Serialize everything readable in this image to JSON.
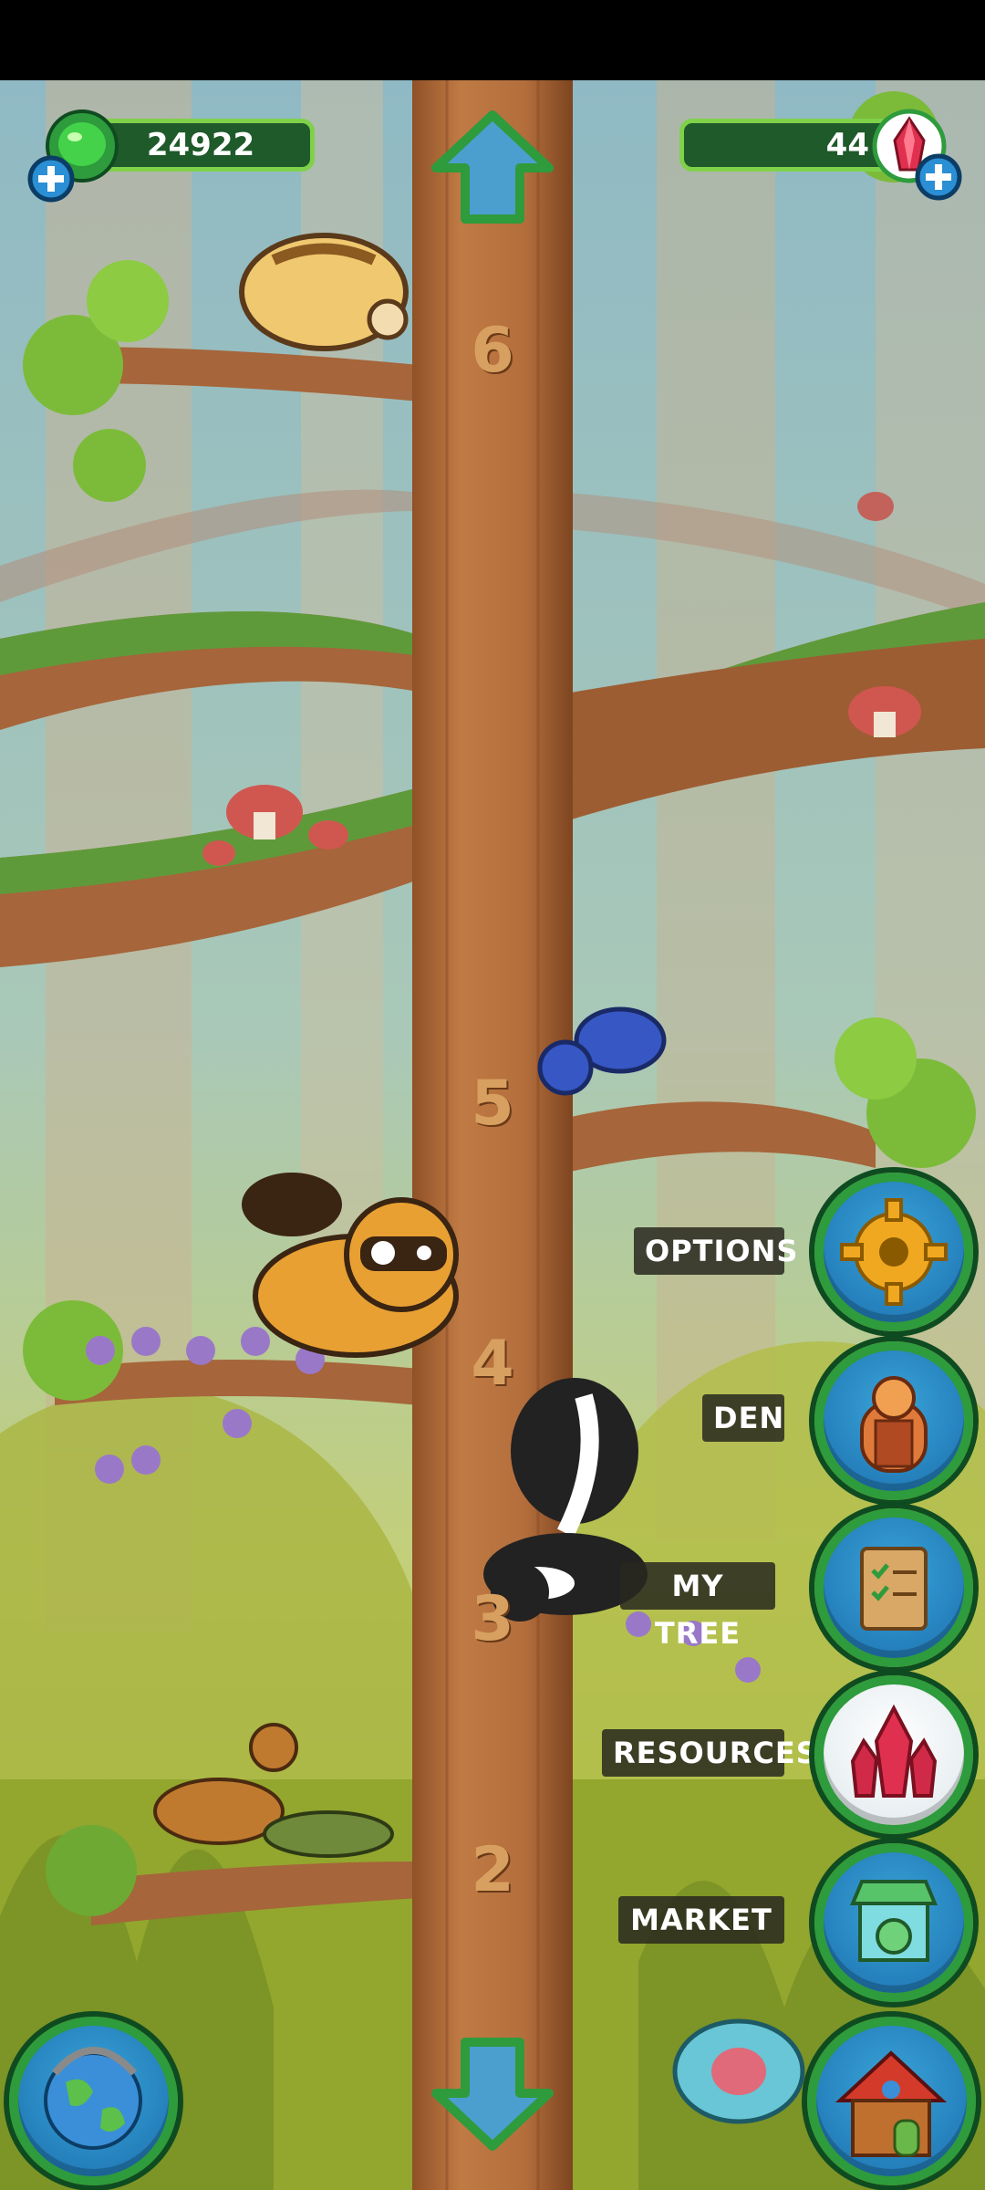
{
  "hud": {
    "gems_count": "24922",
    "crystals_count": "44"
  },
  "tree": {
    "level_markers": [
      "6",
      "5",
      "4",
      "3",
      "2"
    ]
  },
  "menu": {
    "options_label": "OPTIONS",
    "den_label": "DEN",
    "my_tree_label": "MY TREE",
    "resources_label": "RESOURCES",
    "market_label": "MARKET"
  },
  "icons": {
    "gem": "green-gem-icon",
    "crystal": "red-crystal-icon",
    "plus": "plus-icon",
    "up": "arrow-up-icon",
    "down": "arrow-down-icon",
    "options": "gear-icon",
    "den": "den-door-icon",
    "my_tree": "checklist-board-icon",
    "resources": "crystal-cluster-icon",
    "market": "market-stall-icon",
    "world": "globe-icon",
    "home": "treehouse-icon"
  },
  "colors": {
    "trunk": "#b06a3a",
    "hud_green": "#1f5a2a",
    "accent_green": "#7fd14a"
  }
}
